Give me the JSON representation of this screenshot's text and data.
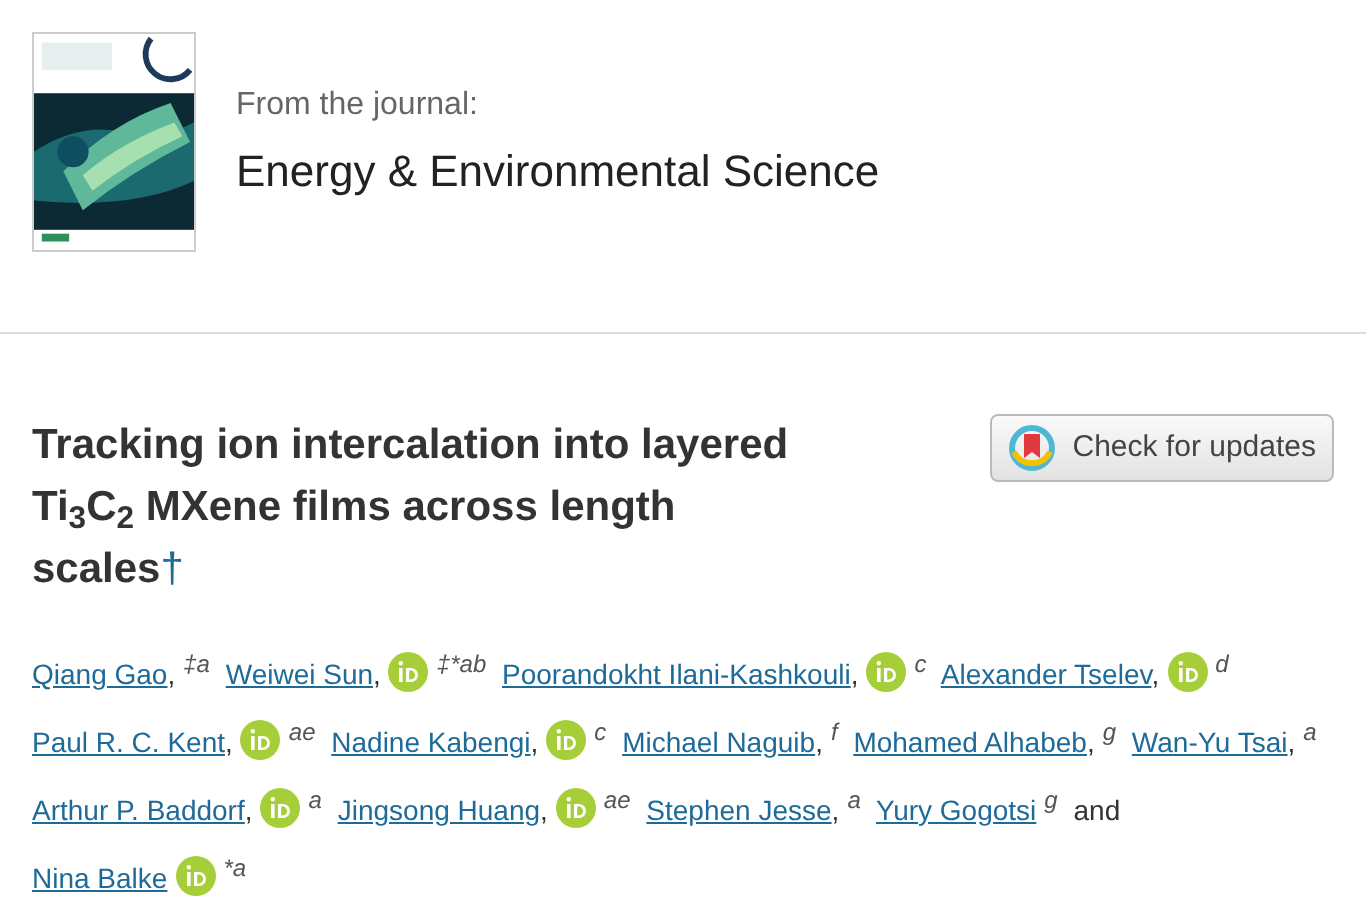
{
  "journal": {
    "label": "From the journal:",
    "name": "Energy & Environmental Science"
  },
  "article": {
    "title": "Tracking ion intercalation into layered Ti$_{3}$C$_{2}$ MXene films across length scales",
    "footnote_link": "†"
  },
  "check_updates": {
    "label": "Check for updates"
  },
  "authors": [
    {
      "kind": "author",
      "name": "Qiang Gao",
      "comma": ",",
      "orcid": false,
      "sup": "‡a"
    },
    {
      "kind": "author",
      "name": "Weiwei Sun",
      "comma": ",",
      "orcid": true,
      "sup": "‡*ab"
    },
    {
      "kind": "author",
      "name": "Poorandokht Ilani-Kashkouli",
      "comma": ",",
      "orcid": true,
      "sup": "c"
    },
    {
      "kind": "author",
      "name": "Alexander Tselev",
      "comma": ",",
      "orcid": true,
      "sup": "d"
    },
    {
      "kind": "author",
      "name": "Paul R. C. Kent",
      "comma": ",",
      "orcid": true,
      "sup": "ae"
    },
    {
      "kind": "author",
      "name": "Nadine Kabengi",
      "comma": ",",
      "orcid": true,
      "sup": "c"
    },
    {
      "kind": "author",
      "name": "Michael Naguib",
      "comma": ",",
      "orcid": false,
      "sup": "f"
    },
    {
      "kind": "author",
      "name": "Mohamed Alhabeb",
      "comma": ",",
      "orcid": false,
      "sup": "g"
    },
    {
      "kind": "author",
      "name": "Wan-Yu Tsai",
      "comma": ",",
      "orcid": false,
      "sup": "a"
    },
    {
      "kind": "author",
      "name": "Arthur P. Baddorf",
      "comma": ",",
      "orcid": true,
      "sup": "a"
    },
    {
      "kind": "author",
      "name": "Jingsong Huang",
      "comma": ",",
      "orcid": true,
      "sup": "ae"
    },
    {
      "kind": "author",
      "name": "Stephen Jesse",
      "comma": ",",
      "orcid": false,
      "sup": "a"
    },
    {
      "kind": "author",
      "name": "Yury Gogotsi",
      "orcid": false,
      "sup": "g"
    },
    {
      "kind": "text",
      "text": "and"
    },
    {
      "kind": "author",
      "name": "Nina Balke",
      "orcid": true,
      "sup": "*a"
    }
  ]
}
